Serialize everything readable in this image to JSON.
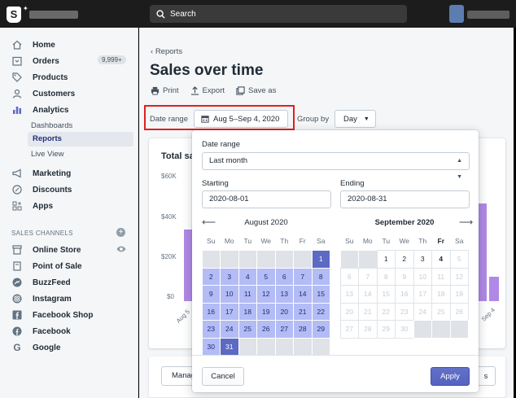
{
  "topbar": {
    "search_placeholder": "Search"
  },
  "sidebar": {
    "items": [
      {
        "label": "Home",
        "icon": "home-icon"
      },
      {
        "label": "Orders",
        "icon": "orders-icon",
        "badge": "9,999+"
      },
      {
        "label": "Products",
        "icon": "tag-icon"
      },
      {
        "label": "Customers",
        "icon": "person-icon"
      },
      {
        "label": "Analytics",
        "icon": "analytics-icon"
      },
      {
        "label": "Marketing",
        "icon": "megaphone-icon"
      },
      {
        "label": "Discounts",
        "icon": "discount-icon"
      },
      {
        "label": "Apps",
        "icon": "apps-icon"
      }
    ],
    "analytics_sub": [
      "Dashboards",
      "Reports",
      "Live View"
    ],
    "channels_header": "SALES CHANNELS",
    "channels": [
      {
        "label": "Online Store",
        "icon": "store-icon"
      },
      {
        "label": "Point of Sale",
        "icon": "pos-icon"
      },
      {
        "label": "BuzzFeed",
        "icon": "buzzfeed-icon"
      },
      {
        "label": "Instagram",
        "icon": "instagram-icon"
      },
      {
        "label": "Facebook Shop",
        "icon": "facebook-icon"
      },
      {
        "label": "Facebook",
        "icon": "facebook-icon"
      },
      {
        "label": "Google",
        "icon": "google-icon"
      }
    ]
  },
  "main": {
    "back_label": "Reports",
    "title": "Sales over time",
    "actions": [
      "Print",
      "Export",
      "Save as"
    ],
    "date_range_label": "Date range",
    "date_range_value": "Aug 5–Sep 4, 2020",
    "group_by_label": "Group by",
    "group_by_value": "Day",
    "card_title": "Total sa",
    "y_ticks": [
      "$60K",
      "$40K",
      "$20K",
      "$0"
    ],
    "x_first": "Aug 5",
    "x_last": "Sep 4",
    "manage_label": "Manag",
    "right_stub": "s"
  },
  "popover": {
    "date_range_label": "Date range",
    "preset": "Last month",
    "starting_label": "Starting",
    "starting_value": "2020-08-01",
    "ending_label": "Ending",
    "ending_value": "2020-08-31",
    "month_left": "August 2020",
    "month_right": "September 2020",
    "weekdays": [
      "Su",
      "Mo",
      "Tu",
      "We",
      "Th",
      "Fr",
      "Sa"
    ],
    "cancel_label": "Cancel",
    "apply_label": "Apply"
  },
  "colors": {
    "accent": "#5c6ac4",
    "range": "#b3bcf5",
    "chart_bar": "#b089e6",
    "highlight_box": "#e02020"
  }
}
